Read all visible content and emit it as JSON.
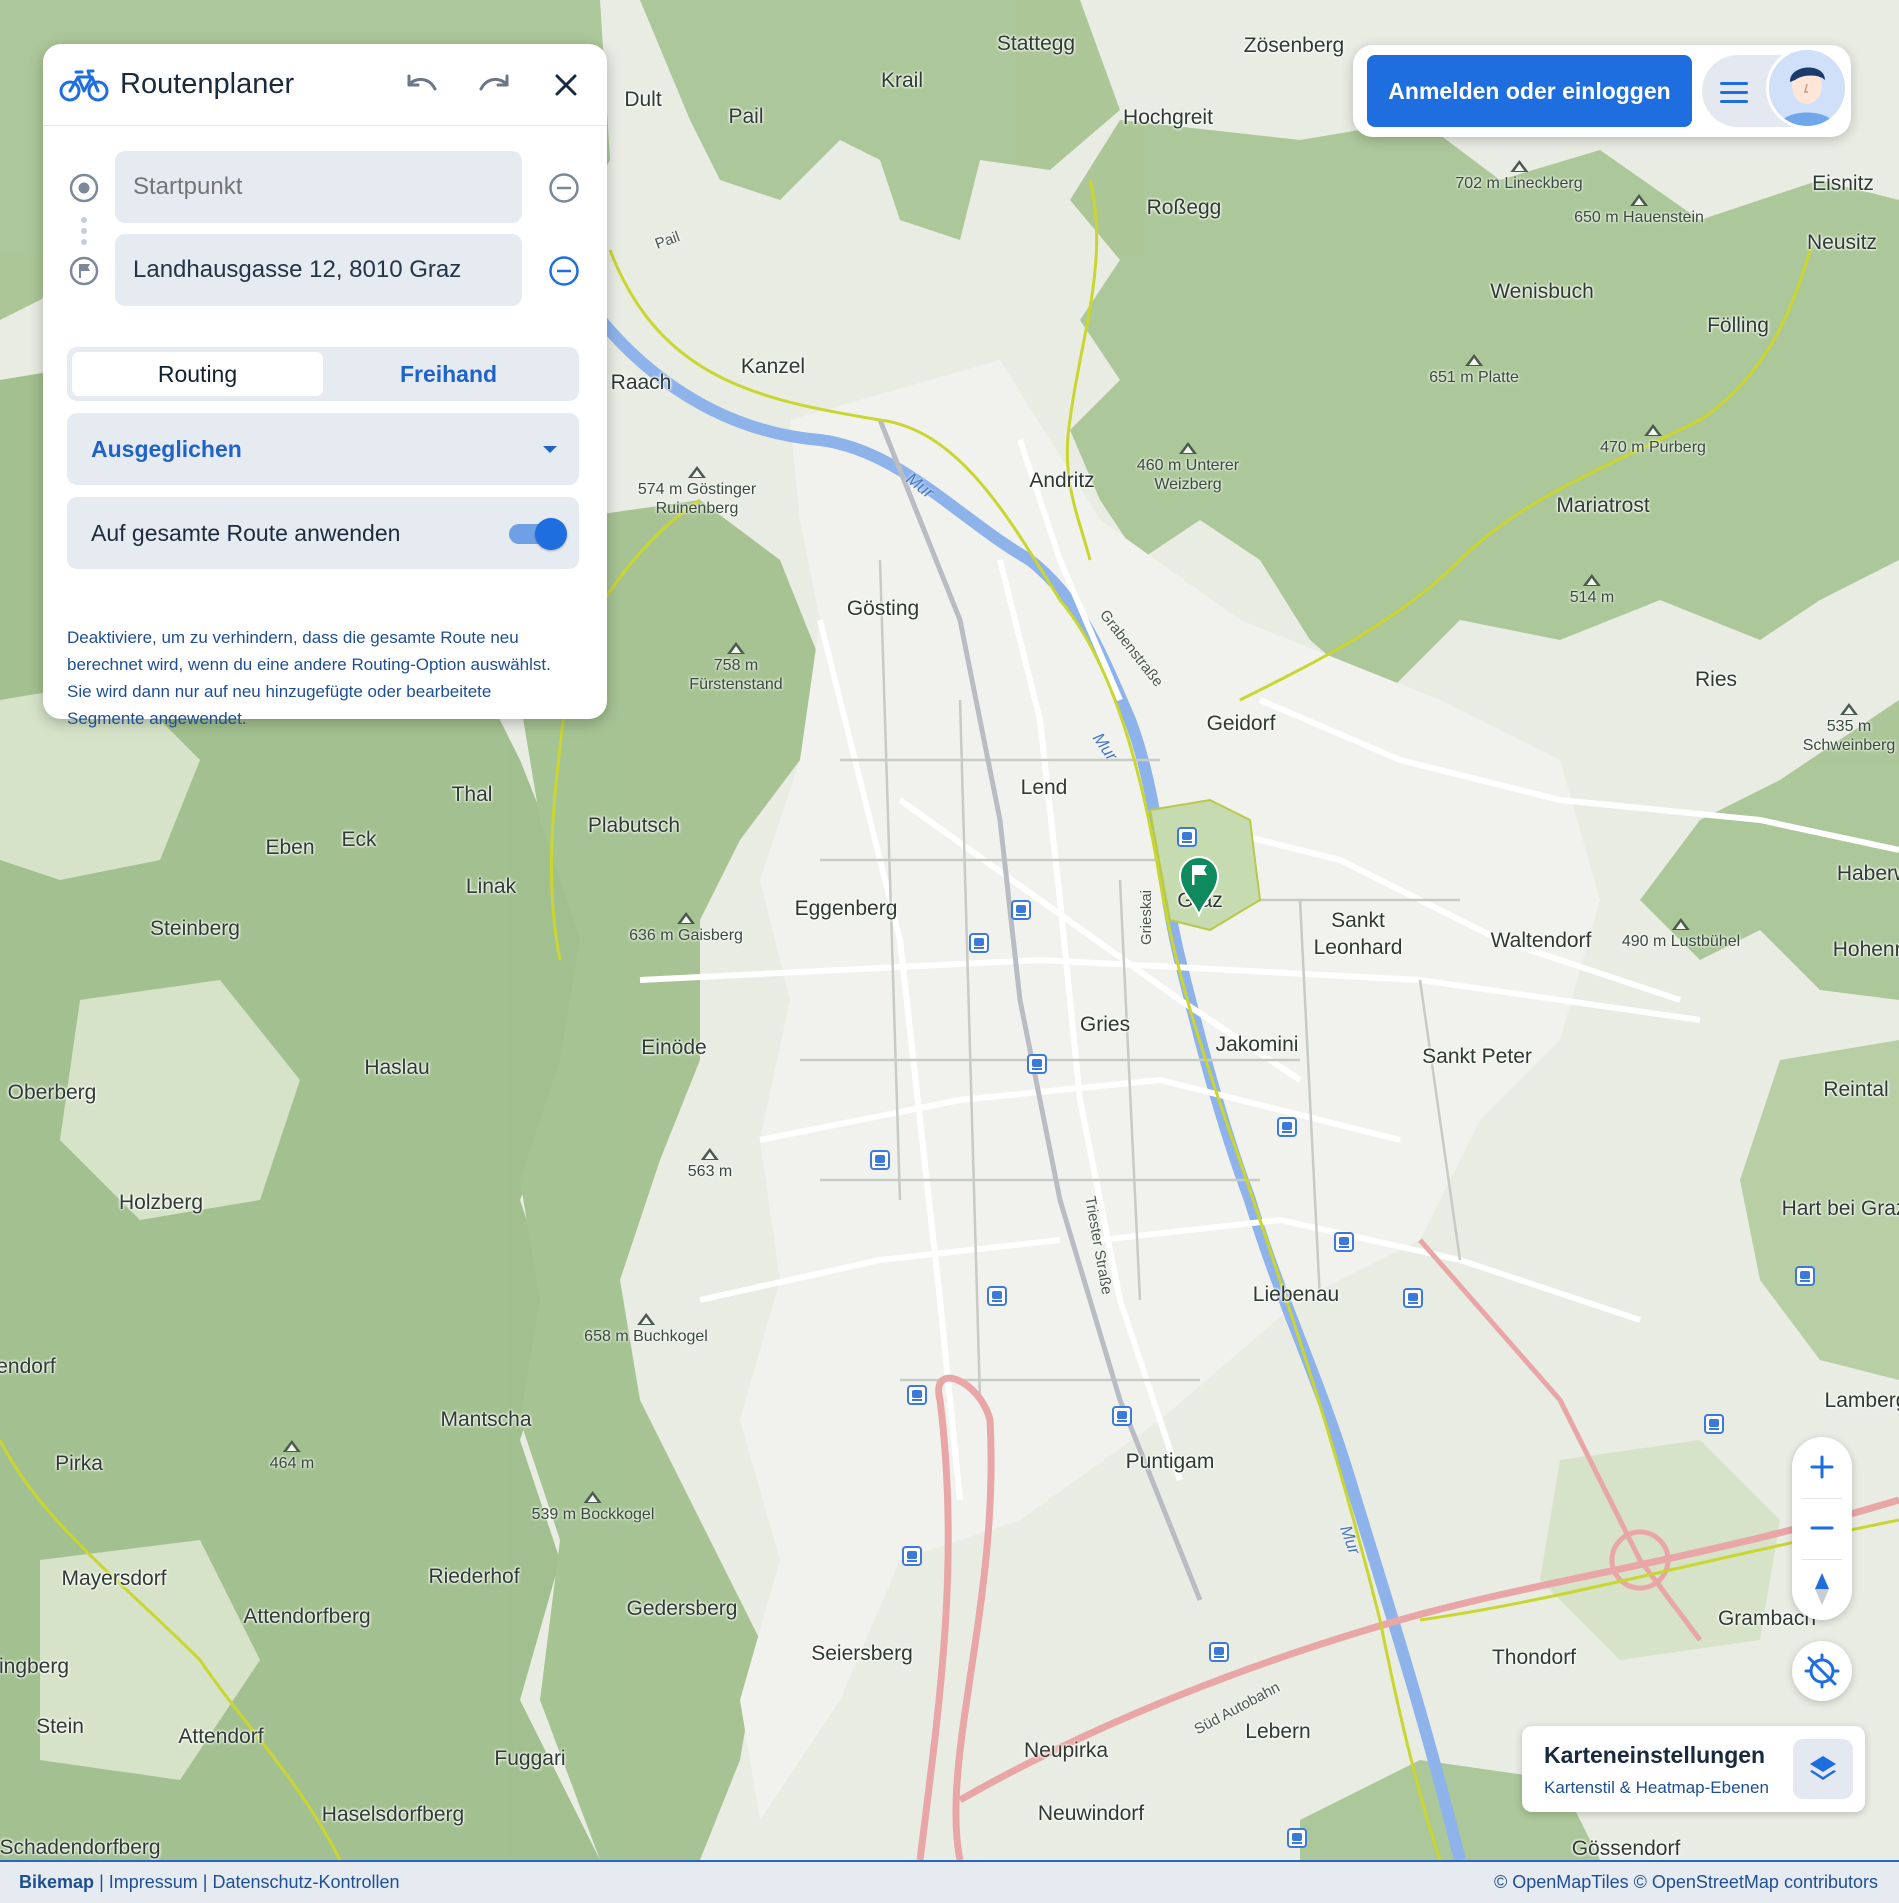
{
  "planner": {
    "title": "Routenplaner",
    "start_placeholder": "Startpunkt",
    "destination_value": "Landhausgasse 12, 8010 Graz",
    "modes": [
      "Routing",
      "Freihand"
    ],
    "active_mode": "Routing",
    "profile": "Ausgeglichen",
    "apply_toggle_label": "Auf gesamte Route anwenden",
    "apply_toggle_on": true,
    "hint_lines": [
      "Deaktiviere, um zu verhindern, dass die gesamte Route neu",
      "berechnet wird, wenn du eine andere Routing-Option auswählst.",
      "Sie wird dann nur auf neu hinzugefügte oder bearbeitete",
      "Segmente angewendet."
    ]
  },
  "account": {
    "login_label": "Anmelden oder einloggen"
  },
  "map_settings": {
    "title": "Karteneinstellungen",
    "subtitle": "Kartenstil & Heatmap-Ebenen"
  },
  "footer": {
    "brand": "Bikemap",
    "links": [
      "Impressum",
      "Datenschutz-Kontrollen"
    ],
    "attribution": [
      "© OpenMapTiles",
      "© OpenStreetMap contributors"
    ]
  },
  "colors": {
    "accent": "#1e6ee0",
    "route_green": "#0f8a5f",
    "cycle_path": "#c9d630",
    "motorway": "#e9a6a6",
    "river": "#8db3ea"
  },
  "map": {
    "places": [
      "Stattegg",
      "Zösenberg",
      "Krail",
      "Dult",
      "Pail",
      "Hochgreit",
      "Roßegg",
      "Eisnitz",
      "Neusitz",
      "Wenisbuch",
      "Fölling",
      "Kanzel",
      "Raach",
      "Andritz",
      "Mariatrost",
      "Gösting",
      "Geidorf",
      "Ries",
      "Lend",
      "Thal",
      "Plabutsch",
      "Eben",
      "Eck",
      "Linak",
      "Steinberg",
      "Eggenberg",
      "Graz",
      "Sankt Leonhard",
      "Waltendorf",
      "Haberw",
      "Hohenra",
      "Gries",
      "Jakomini",
      "Sankt Peter",
      "Einöde",
      "Haslau",
      "Oberberg",
      "Reintal",
      "Holzberg",
      "Hart bei Graz",
      "Liebenau",
      "Mantscha",
      "Pirka",
      "Puntigam",
      "Mayersdorf",
      "Riederhof",
      "Attendorfberg",
      "Gedersberg",
      "Seiersberg",
      "Thondorf",
      "Grambach",
      "Lamberg",
      "Stein",
      "Attendorf",
      "Fuggari",
      "Neupirka",
      "Lebern",
      "Haselsdorfberg",
      "Neuwindorf",
      "Schadendorfberg",
      "Gössendorf",
      "endorf",
      "ingberg"
    ],
    "peaks": [
      "702 m Lineckberg",
      "650 m Hauenstein",
      "651 m Platte",
      "470 m Purberg",
      "460 m Unterer Weizberg",
      "574 m Göstinger Ruinenberg",
      "514 m",
      "758 m Fürstenstand",
      "535 m Schweinberg",
      "636 m Gaisberg",
      "490 m Lustbühel",
      "563 m",
      "658 m Buchkogel",
      "464 m",
      "539 m Bockkogel"
    ],
    "streets": [
      "Grabenstraße",
      "Grieskai",
      "Triester Straße",
      "Süd Autobahn",
      "Pail"
    ],
    "rivers": [
      "Mur",
      "Mur",
      "Mur"
    ]
  }
}
